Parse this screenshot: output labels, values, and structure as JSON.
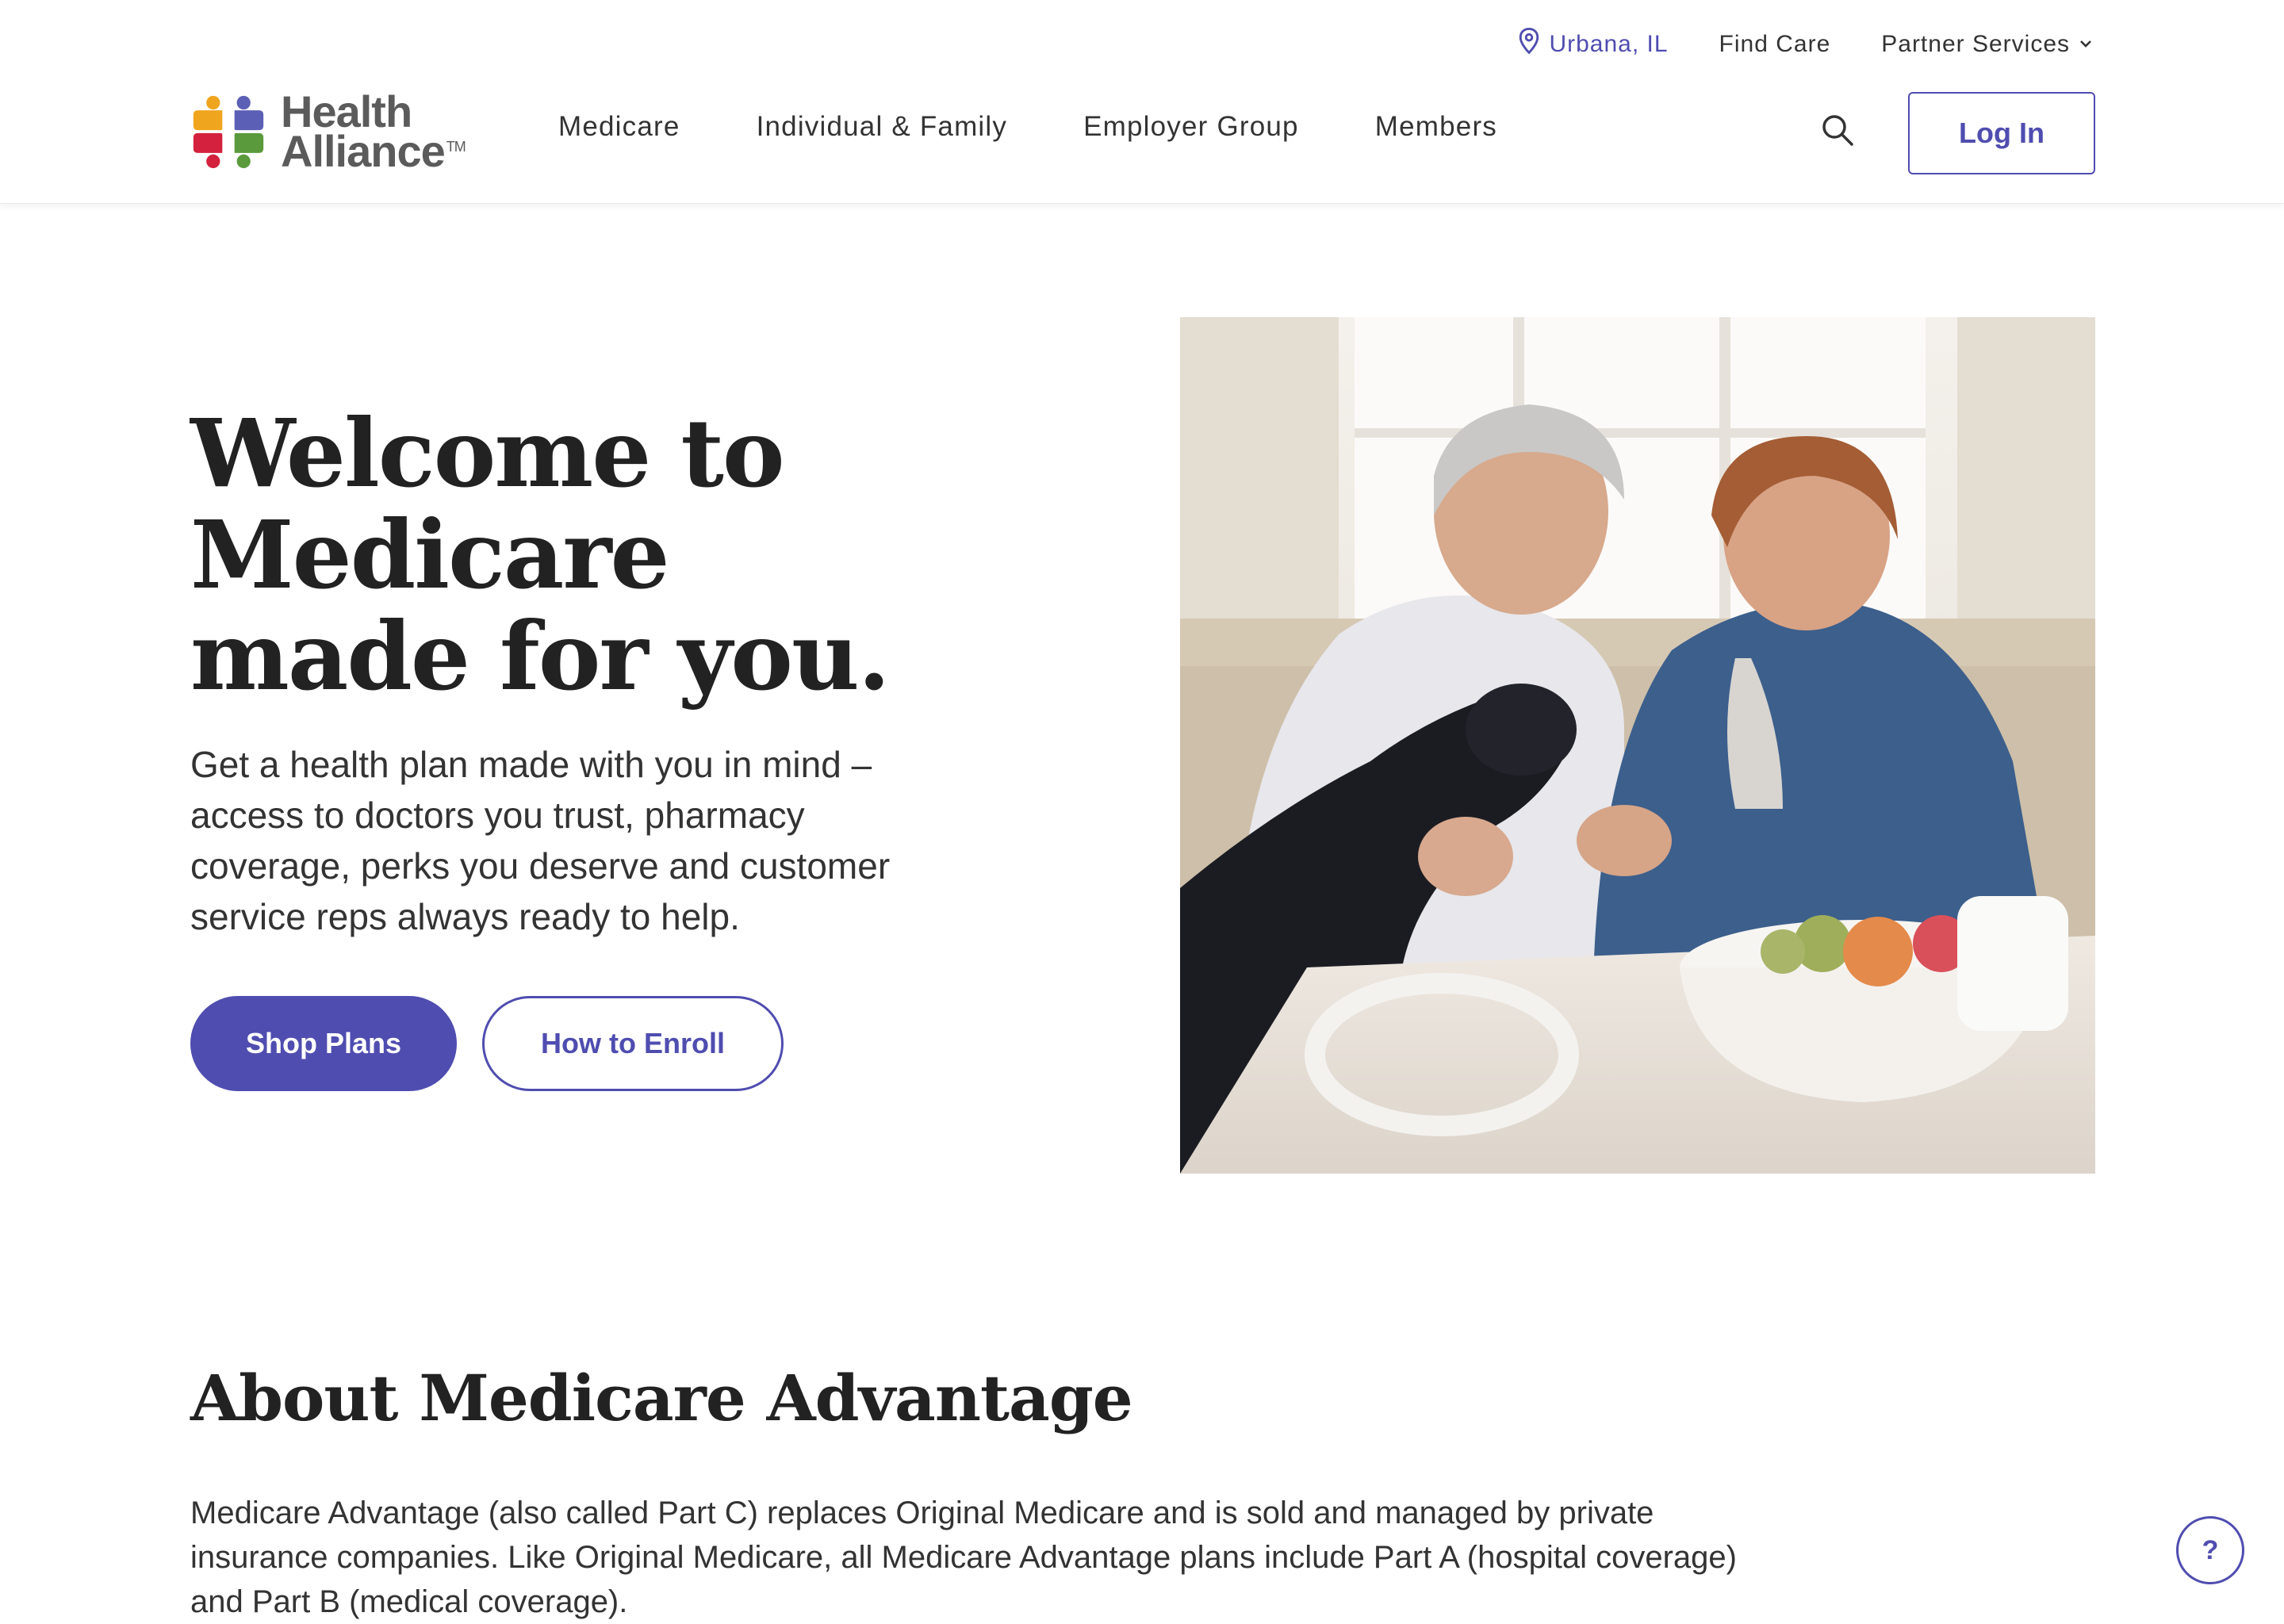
{
  "utility_nav": {
    "location": "Urbana, IL",
    "find_care": "Find Care",
    "partner_services": "Partner Services"
  },
  "logo": {
    "line1": "Health",
    "line2": "Alliance",
    "trademark": "TM",
    "colors": [
      "#f0a51e",
      "#5b5fb5",
      "#d4213d",
      "#5a9a3c"
    ]
  },
  "main_nav": {
    "items": [
      "Medicare",
      "Individual & Family",
      "Employer Group",
      "Members"
    ]
  },
  "header": {
    "search_icon": "search-icon",
    "login_label": "Log In"
  },
  "hero": {
    "title": "Welcome to Medicare made for you.",
    "subtitle": "Get a health plan made with you in mind – access to doctors you trust, pharmacy coverage, perks you deserve and customer service reps always ready to help.",
    "primary_cta": "Shop Plans",
    "secondary_cta": "How to Enroll"
  },
  "about": {
    "title": "About Medicare Advantage",
    "body": "Medicare Advantage (also called Part C) replaces Original Medicare and is sold and managed by private insurance companies. Like Original Medicare, all Medicare Advantage plans include Part A (hospital coverage) and Part B (medical coverage)."
  },
  "help_button": {
    "label": "?"
  },
  "colors": {
    "accent": "#4f4db0",
    "text": "#333333",
    "heading": "#222222"
  }
}
